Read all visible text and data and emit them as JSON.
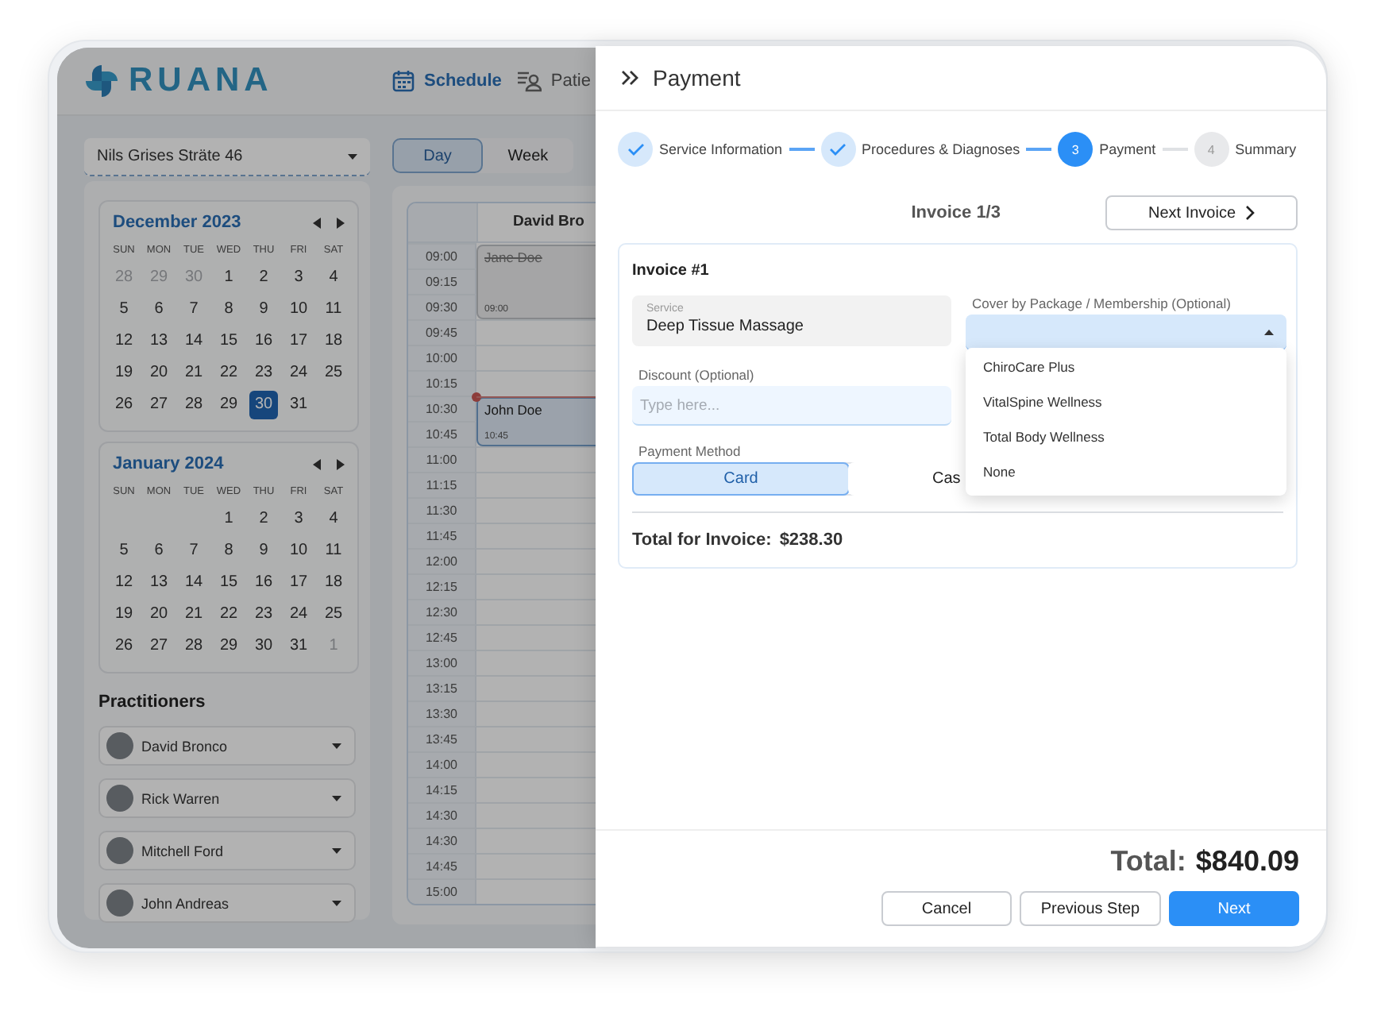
{
  "app": {
    "logo": "RUANA",
    "nav": [
      {
        "label": "Schedule",
        "selected": true
      },
      {
        "label": "Patie",
        "selected": false
      }
    ]
  },
  "location_select": {
    "value": "Nils Grises Sträte 46"
  },
  "view_toggle": [
    {
      "label": "Day",
      "selected": true
    },
    {
      "label": "Week",
      "selected": false
    }
  ],
  "calendars": [
    {
      "title": "December 2023",
      "weekdays": [
        "SUN",
        "MON",
        "TUE",
        "WED",
        "THU",
        "FRI",
        "SAT"
      ],
      "weeks": [
        [
          {
            "day": "28",
            "muted": true,
            "selected": false
          },
          {
            "day": "29",
            "muted": true,
            "selected": false
          },
          {
            "day": "30",
            "muted": true,
            "selected": false
          },
          {
            "day": "1",
            "muted": false,
            "selected": false
          },
          {
            "day": "2",
            "muted": false,
            "selected": false
          },
          {
            "day": "3",
            "muted": false,
            "selected": false
          },
          {
            "day": "4",
            "muted": false,
            "selected": false
          }
        ],
        [
          {
            "day": "5",
            "muted": false,
            "selected": false
          },
          {
            "day": "6",
            "muted": false,
            "selected": false
          },
          {
            "day": "7",
            "muted": false,
            "selected": false
          },
          {
            "day": "8",
            "muted": false,
            "selected": false
          },
          {
            "day": "9",
            "muted": false,
            "selected": false
          },
          {
            "day": "10",
            "muted": false,
            "selected": false
          },
          {
            "day": "11",
            "muted": false,
            "selected": false
          }
        ],
        [
          {
            "day": "12",
            "muted": false,
            "selected": false
          },
          {
            "day": "13",
            "muted": false,
            "selected": false
          },
          {
            "day": "14",
            "muted": false,
            "selected": false
          },
          {
            "day": "15",
            "muted": false,
            "selected": false
          },
          {
            "day": "16",
            "muted": false,
            "selected": false
          },
          {
            "day": "17",
            "muted": false,
            "selected": false
          },
          {
            "day": "18",
            "muted": false,
            "selected": false
          }
        ],
        [
          {
            "day": "19",
            "muted": false,
            "selected": false
          },
          {
            "day": "20",
            "muted": false,
            "selected": false
          },
          {
            "day": "21",
            "muted": false,
            "selected": false
          },
          {
            "day": "22",
            "muted": false,
            "selected": false
          },
          {
            "day": "23",
            "muted": false,
            "selected": false
          },
          {
            "day": "24",
            "muted": false,
            "selected": false
          },
          {
            "day": "25",
            "muted": false,
            "selected": false
          }
        ],
        [
          {
            "day": "26",
            "muted": false,
            "selected": false
          },
          {
            "day": "27",
            "muted": false,
            "selected": false
          },
          {
            "day": "28",
            "muted": false,
            "selected": false
          },
          {
            "day": "29",
            "muted": false,
            "selected": false
          },
          {
            "day": "30",
            "muted": false,
            "selected": true
          },
          {
            "day": "31",
            "muted": false,
            "selected": false
          }
        ]
      ]
    },
    {
      "title": "January 2024",
      "weekdays": [
        "SUN",
        "MON",
        "TUE",
        "WED",
        "THU",
        "FRI",
        "SAT"
      ],
      "weeks": [
        [
          {
            "day": "1",
            "muted": false,
            "selected": false
          },
          {
            "day": "2",
            "muted": false,
            "selected": false
          },
          {
            "day": "3",
            "muted": false,
            "selected": false
          },
          {
            "day": "4",
            "muted": false,
            "selected": false
          }
        ],
        [
          {
            "day": "5",
            "muted": false,
            "selected": false
          },
          {
            "day": "6",
            "muted": false,
            "selected": false
          },
          {
            "day": "7",
            "muted": false,
            "selected": false
          },
          {
            "day": "8",
            "muted": false,
            "selected": false
          },
          {
            "day": "9",
            "muted": false,
            "selected": false
          },
          {
            "day": "10",
            "muted": false,
            "selected": false
          },
          {
            "day": "11",
            "muted": false,
            "selected": false
          }
        ],
        [
          {
            "day": "12",
            "muted": false,
            "selected": false
          },
          {
            "day": "13",
            "muted": false,
            "selected": false
          },
          {
            "day": "14",
            "muted": false,
            "selected": false
          },
          {
            "day": "15",
            "muted": false,
            "selected": false
          },
          {
            "day": "16",
            "muted": false,
            "selected": false
          },
          {
            "day": "17",
            "muted": false,
            "selected": false
          },
          {
            "day": "18",
            "muted": false,
            "selected": false
          }
        ],
        [
          {
            "day": "19",
            "muted": false,
            "selected": false
          },
          {
            "day": "20",
            "muted": false,
            "selected": false
          },
          {
            "day": "21",
            "muted": false,
            "selected": false
          },
          {
            "day": "22",
            "muted": false,
            "selected": false
          },
          {
            "day": "23",
            "muted": false,
            "selected": false
          },
          {
            "day": "24",
            "muted": false,
            "selected": false
          },
          {
            "day": "25",
            "muted": false,
            "selected": false
          }
        ],
        [
          {
            "day": "26",
            "muted": false,
            "selected": false
          },
          {
            "day": "27",
            "muted": false,
            "selected": false
          },
          {
            "day": "28",
            "muted": false,
            "selected": false
          },
          {
            "day": "29",
            "muted": false,
            "selected": false
          },
          {
            "day": "30",
            "muted": false,
            "selected": false
          },
          {
            "day": "31",
            "muted": false,
            "selected": false
          },
          {
            "day": "1",
            "muted": true,
            "selected": false
          }
        ]
      ]
    }
  ],
  "practitioners": {
    "title": "Practitioners",
    "items": [
      {
        "name": "David Bronco"
      },
      {
        "name": "Rick Warren"
      },
      {
        "name": "Mitchell Ford"
      },
      {
        "name": "John Andreas"
      }
    ]
  },
  "schedule": {
    "columns": [
      "David Bro"
    ],
    "slots": [
      {
        "time": "09:00",
        "kind": "booked",
        "appointment": {
          "name": "Jane Doe",
          "time": "09:00",
          "cancelled": true,
          "now": false
        }
      },
      {
        "time": "09:15",
        "kind": "continued"
      },
      {
        "time": "09:30",
        "kind": "continued"
      },
      {
        "time": "09:45",
        "kind": "free"
      },
      {
        "time": "10:00",
        "kind": "free"
      },
      {
        "time": "10:15",
        "kind": "free"
      },
      {
        "time": "10:30",
        "kind": "booked",
        "appointment": {
          "name": "John Doe",
          "time": "10:45",
          "cancelled": false,
          "now": true
        }
      },
      {
        "time": "10:45",
        "kind": "continued"
      },
      {
        "time": "11:00",
        "kind": "free"
      },
      {
        "time": "11:15",
        "kind": "free"
      },
      {
        "time": "11:30",
        "kind": "free"
      },
      {
        "time": "11:45",
        "kind": "free"
      },
      {
        "time": "12:00",
        "kind": "free"
      },
      {
        "time": "12:15",
        "kind": "free"
      },
      {
        "time": "12:30",
        "kind": "free"
      },
      {
        "time": "12:45",
        "kind": "free"
      },
      {
        "time": "13:00",
        "kind": "free"
      },
      {
        "time": "13:15",
        "kind": "free"
      },
      {
        "time": "13:30",
        "kind": "free"
      },
      {
        "time": "13:45",
        "kind": "free"
      },
      {
        "time": "14:00",
        "kind": "free"
      },
      {
        "time": "14:15",
        "kind": "free"
      },
      {
        "time": "14:30",
        "kind": "free"
      },
      {
        "time": "14:30",
        "kind": "free"
      },
      {
        "time": "14:45",
        "kind": "free"
      },
      {
        "time": "15:00",
        "kind": "free"
      }
    ]
  },
  "panel": {
    "title": "Payment",
    "steps": [
      {
        "label": "Service Information",
        "kind": "done"
      },
      {
        "label": "Procedures & Diagnoses",
        "kind": "done"
      },
      {
        "label": "Payment",
        "number": "3",
        "kind": "current"
      },
      {
        "label": "Summary",
        "number": "4",
        "kind": "upcoming"
      }
    ],
    "invoice_nav": {
      "title": "Invoice 1/3",
      "button": "Next Invoice"
    },
    "invoice": {
      "title": "Invoice #1",
      "service": {
        "label": "Service",
        "value": "Deep Tissue Massage"
      },
      "cover": {
        "label": "Cover by Package / Membership (Optional)",
        "expanded": true,
        "options": [
          {
            "label": "ChiroCare Plus",
            "selected": false
          },
          {
            "label": "VitalSpine Wellness",
            "selected": false
          },
          {
            "label": "Total Body Wellness",
            "selected": false
          },
          {
            "label": "None",
            "selected": false
          }
        ]
      },
      "discount": {
        "label": "Discount (Optional)",
        "placeholder": "Type here..."
      },
      "payment_method": {
        "label": "Payment Method",
        "options": [
          {
            "label": "Card",
            "selected": true
          },
          {
            "label": "Cas",
            "selected": false
          }
        ]
      },
      "total_label": "Total for Invoice:",
      "total_value": "$238.30"
    },
    "total": {
      "label": "Total:",
      "value": "$840.09"
    },
    "buttons": [
      {
        "label": "Cancel",
        "kind": "secondary"
      },
      {
        "label": "Previous Step",
        "kind": "secondary"
      },
      {
        "label": "Next",
        "kind": "primary"
      }
    ]
  }
}
